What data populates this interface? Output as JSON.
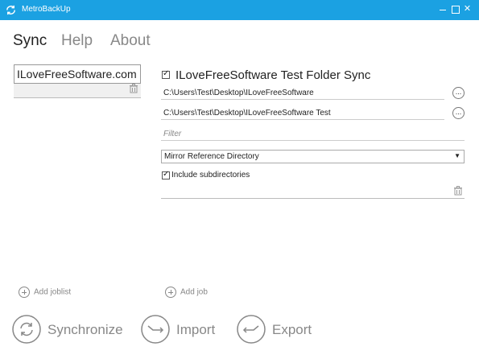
{
  "window": {
    "title": "MetroBackUp",
    "controls": {
      "minimize": "",
      "maximize": "",
      "close": "✕"
    },
    "accent": "#1ba1e2"
  },
  "nav": {
    "tabs": [
      {
        "label": "Sync",
        "active": true
      },
      {
        "label": "Help",
        "active": false
      },
      {
        "label": "About",
        "active": false
      }
    ]
  },
  "joblist": {
    "current_value": "ILoveFreeSoftware.com",
    "add_label": "Add joblist"
  },
  "job": {
    "enabled": true,
    "title": "ILoveFreeSoftware Test Folder Sync",
    "source_path": "C:\\Users\\Test\\Desktop\\ILoveFreeSoftware",
    "destination_path": "C:\\Users\\Test\\Desktop\\ILoveFreeSoftware Test",
    "browse_label": "...",
    "filter_placeholder": "Filter",
    "mode_selected": "Mirror Reference Directory",
    "include_subdirectories": true,
    "include_subdirectories_label": "Include subdirectories",
    "add_label": "Add job"
  },
  "actions": {
    "synchronize": "Synchronize",
    "import": "Import",
    "export": "Export"
  },
  "icons": {
    "app": "sync-circle-icon",
    "delete": "trash-icon",
    "add": "plus-circle-icon",
    "synchronize": "sync-arrows-icon",
    "import": "import-arrow-icon",
    "export": "export-arrow-icon"
  }
}
